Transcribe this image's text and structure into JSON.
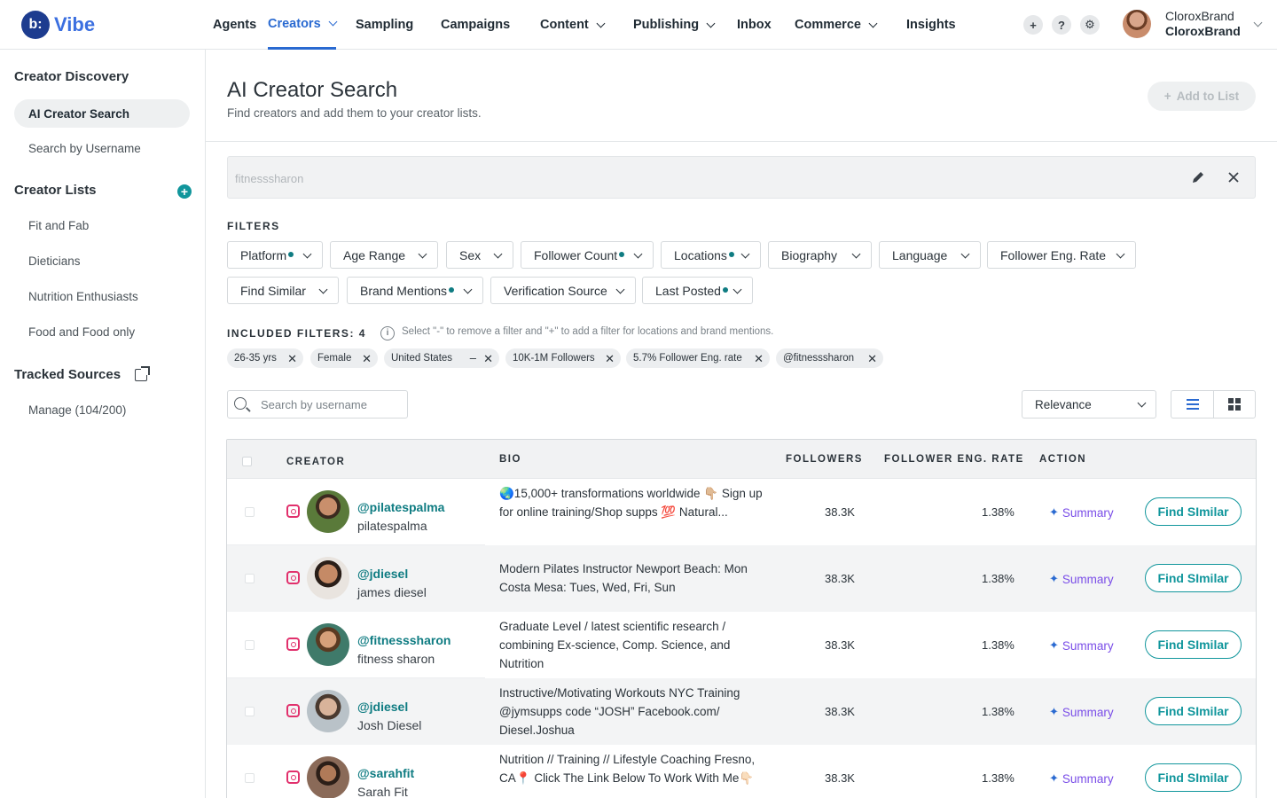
{
  "app": {
    "logo_mark": "b:",
    "name": "Vibe",
    "brand_color": "#2a6ad1",
    "accent_color": "#11969c"
  },
  "nav": {
    "items": [
      {
        "label": "Agents",
        "dropdown": false
      },
      {
        "label": "Creators",
        "dropdown": true,
        "active": true
      },
      {
        "label": "Sampling",
        "dropdown": false
      },
      {
        "label": "Campaigns",
        "dropdown": false
      },
      {
        "label": "Content",
        "dropdown": true
      },
      {
        "label": "Publishing",
        "dropdown": true
      },
      {
        "label": "Inbox",
        "dropdown": false
      },
      {
        "label": "Commerce",
        "dropdown": true
      },
      {
        "label": "Insights",
        "dropdown": false
      }
    ],
    "actions": [
      {
        "icon": "plus-icon",
        "glyph": "+"
      },
      {
        "icon": "help-icon",
        "glyph": "?"
      },
      {
        "icon": "gear-icon",
        "glyph": "⚙"
      }
    ],
    "user": {
      "line1": "CloroxBrand",
      "line2": "CloroxBrand"
    }
  },
  "sidebar": {
    "discovery_heading": "Creator Discovery",
    "discovery_items": [
      "AI Creator Search",
      "Search by Username"
    ],
    "lists_heading": "Creator Lists",
    "lists_items": [
      "Fit and Fab",
      "Dieticians",
      "Nutrition Enthusiasts",
      "Food and Food only"
    ],
    "tracked_heading": "Tracked Sources",
    "tracked_items": [
      "Manage (104/200)"
    ]
  },
  "page": {
    "title": "AI Creator Search",
    "subtitle": "Find creators and add them to your creator lists.",
    "add_to_list": "Add to List",
    "search_value": "fitnesssharon",
    "filters_label": "FILTERS",
    "filters": [
      {
        "label": "Platform",
        "active": true
      },
      {
        "label": "Age Range",
        "active": false
      },
      {
        "label": "Sex",
        "active": false
      },
      {
        "label": "Follower Count",
        "active": true
      },
      {
        "label": "Locations",
        "active": true
      },
      {
        "label": "Biography",
        "active": false
      },
      {
        "label": "Language",
        "active": false
      },
      {
        "label": "Follower Eng. Rate",
        "active": false
      },
      {
        "label": "Find Similar",
        "active": false
      },
      {
        "label": "Brand Mentions",
        "active": true
      },
      {
        "label": "Verification Source",
        "active": false
      },
      {
        "label": "Last Posted",
        "active": true
      }
    ],
    "included_label": "INCLUDED FILTERS: 4",
    "info_text": "Select \"-\" to remove a filter and \"+\" to add a filter for locations and brand mentions.",
    "chips": [
      "26-35 yrs",
      "Female",
      "United States",
      "10K-1M Followers",
      "5.7% Follower Eng. rate",
      "@fitnesssharon"
    ],
    "username_placeholder": "Search by username",
    "sort_value": "Relevance"
  },
  "table": {
    "headers": {
      "creator": "CREATOR",
      "bio": "BIO",
      "followers": "FOLLOWERS",
      "eng": "FOLLOWER ENG. RATE",
      "action": "ACTION"
    },
    "summary_label": "Summary",
    "find_label": "Find SImilar",
    "rows": [
      {
        "handle": "@pilatespalma",
        "name": "pilatespalma",
        "bio": "🌏15,000+ transformations worldwide 👇🏼 Sign up for online training/Shop supps 💯 Natural...",
        "followers": "38.3K",
        "eng": "1.38%"
      },
      {
        "handle": "@jdiesel",
        "name": "james diesel",
        "bio": "Modern Pilates Instructor Newport Beach: Mon Costa Mesa: Tues, Wed, Fri, Sun",
        "followers": "38.3K",
        "eng": "1.38%"
      },
      {
        "handle": "@fitnesssharon",
        "name": "fitness sharon",
        "bio": "Graduate Level / latest scientific research / combining Ex-science, Comp. Science, and Nutrition",
        "followers": "38.3K",
        "eng": "1.38%"
      },
      {
        "handle": "@jdiesel",
        "name": "Josh Diesel",
        "bio": "Instructive/Motivating Workouts NYC Training @jymsupps code “JOSH” Facebook.com/ Diesel.Joshua",
        "followers": "38.3K",
        "eng": "1.38%"
      },
      {
        "handle": "@sarahfit",
        "name": "Sarah Fit",
        "bio": "Nutrition // Training // Lifestyle Coaching Fresno, CA📍 Click The Link Below To Work With Me👇🏻",
        "followers": "38.3K",
        "eng": "1.38%"
      }
    ]
  }
}
